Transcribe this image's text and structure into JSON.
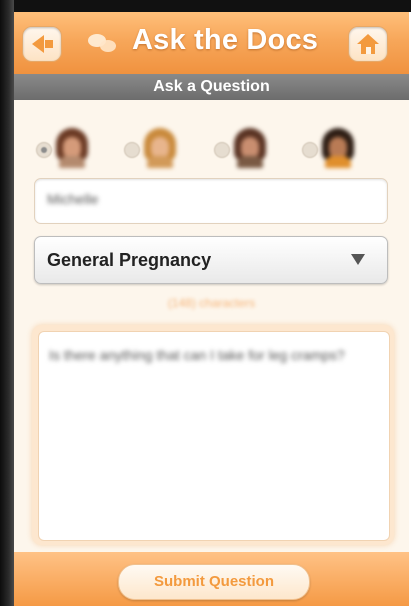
{
  "nav": {
    "back_icon": "back-arrow-icon",
    "chat_icon": "chat-bubbles-icon",
    "title": "Ask the Docs",
    "home_icon": "home-icon"
  },
  "section": {
    "title": "Ask a Question"
  },
  "avatars": [
    {
      "id": "doctor-1",
      "selected": true,
      "hair": "#6b3a24",
      "skin": "#d59b7a",
      "body": "#b48a6e"
    },
    {
      "id": "doctor-2",
      "selected": false,
      "hair": "#c98a3c",
      "skin": "#e8b58d",
      "body": "#d29a59"
    },
    {
      "id": "doctor-3",
      "selected": false,
      "hair": "#5a3323",
      "skin": "#c98e70",
      "body": "#7a5a44"
    },
    {
      "id": "doctor-4",
      "selected": false,
      "hair": "#2d1d14",
      "skin": "#b97b55",
      "body": "#e08f2d"
    }
  ],
  "form": {
    "name_value": "Michelle",
    "category_value": "General Pregnancy",
    "counter_text": "(148) characters",
    "question_text": "Is there anything that can I take for leg cramps?"
  },
  "footer": {
    "submit_label": "Submit Question"
  },
  "colors": {
    "accent": "#f39a3e",
    "navbar_top": "#ffbf7a",
    "section_bar": "#7a7a7a"
  }
}
